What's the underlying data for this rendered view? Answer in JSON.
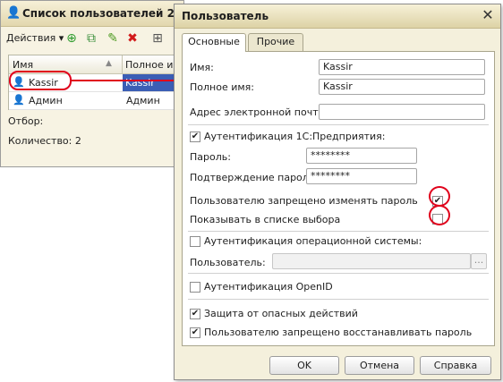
{
  "list_window": {
    "title": "Список пользователей 2",
    "toolbar": {
      "actions_label": "Действия ▾"
    },
    "grid": {
      "headers": [
        "Имя",
        "Полное им"
      ],
      "rows": [
        {
          "name": "Kassir",
          "full_name": "Kassir"
        },
        {
          "name": "Админ",
          "full_name": "Админ"
        }
      ]
    },
    "filter_label": "Отбор:",
    "count_label": "Количество: 2"
  },
  "dialog": {
    "title": "Пользователь",
    "tabs": [
      "Основные",
      "Прочие"
    ],
    "fields": {
      "name_label": "Имя:",
      "name_value": "Kassir",
      "full_name_label": "Полное имя:",
      "full_name_value": "Kassir",
      "email_label": "Адрес электронной почты:",
      "email_value": "",
      "auth_1c_label": "Аутентификация 1С:Предприятия:",
      "password_label": "Пароль:",
      "password_value": "********",
      "confirm_label": "Подтверждение пароля:",
      "confirm_value": "********",
      "deny_change_label": "Пользователю запрещено изменять пароль",
      "show_in_list_label": "Показывать в списке выбора",
      "os_auth_label": "Аутентификация операционной системы:",
      "os_user_label": "Пользователь:",
      "os_user_browse": "...",
      "openid_label": "Аутентификация OpenID",
      "danger_protection_label": "Защита от опасных действий",
      "deny_restore_label": "Пользователю запрещено восстанавливать пароль"
    },
    "checks": {
      "auth_1c": true,
      "deny_change": true,
      "show_in_list": false,
      "os_auth": false,
      "openid": false,
      "danger_protection": true,
      "deny_restore": true
    },
    "buttons": {
      "ok": "OK",
      "cancel": "Отмена",
      "help": "Справка"
    }
  },
  "colors": {
    "annotation": "#e0001b",
    "selection": "#3b5eb5"
  }
}
